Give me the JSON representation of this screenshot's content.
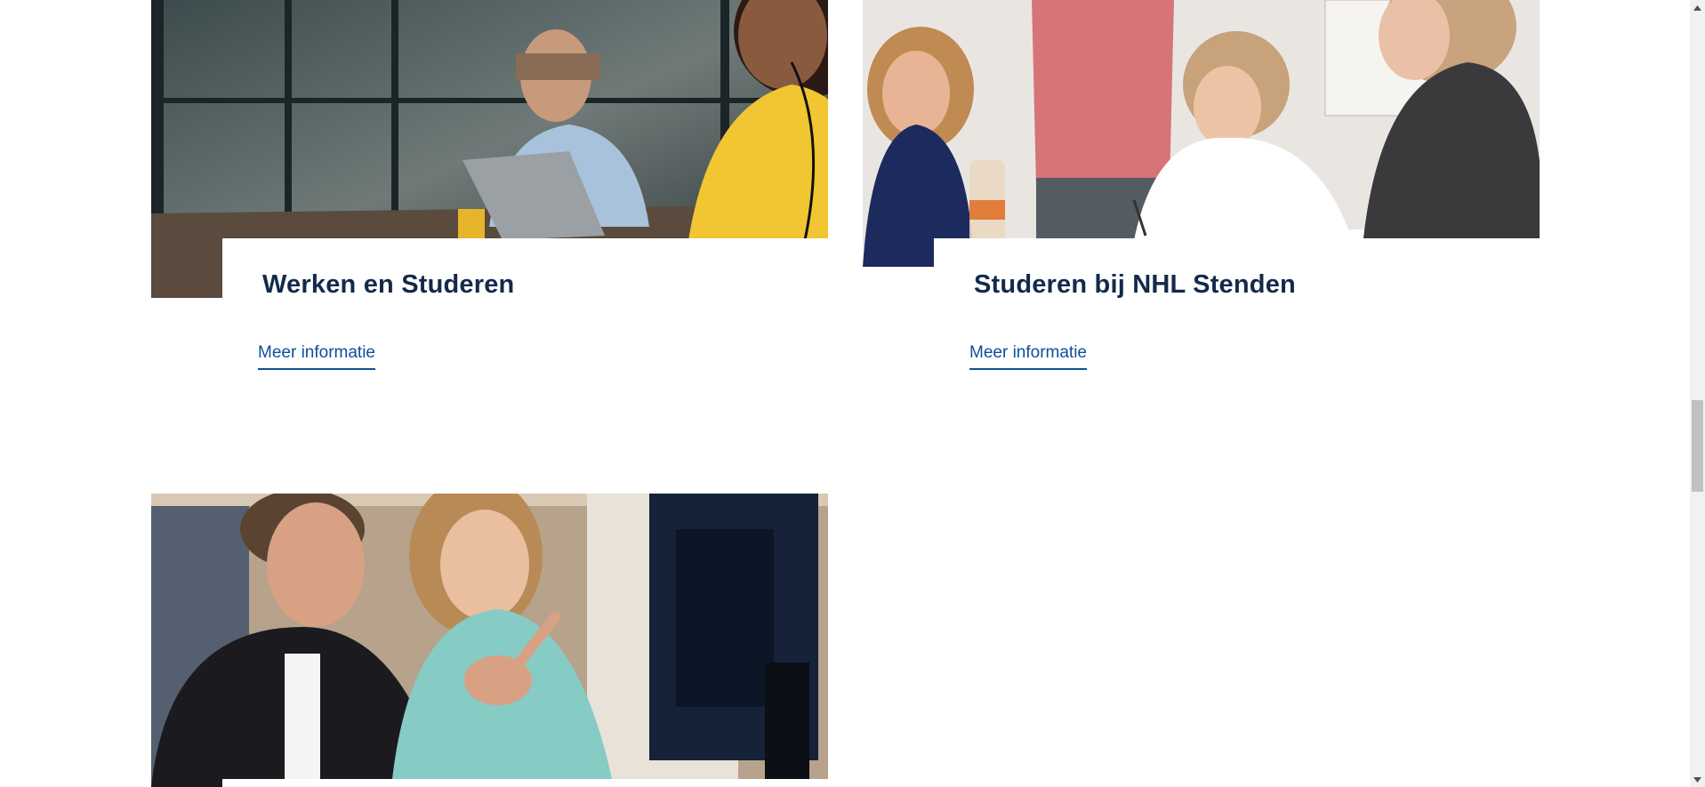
{
  "cards": [
    {
      "title": "Werken en Studeren",
      "link_label": "Meer informatie",
      "image_alt": "Medewerker met headset aan laptop"
    },
    {
      "title": "Studeren bij NHL Stenden",
      "link_label": "Meer informatie",
      "image_alt": "Studenten aan tafel"
    },
    {
      "image_alt": "Twee studenten bij computer"
    }
  ],
  "scrollbar": {
    "up_icon": "triangle-up-icon",
    "down_icon": "triangle-down-icon"
  },
  "colors": {
    "title": "#132a4a",
    "link": "#0d4f9c",
    "background": "#ffffff"
  }
}
